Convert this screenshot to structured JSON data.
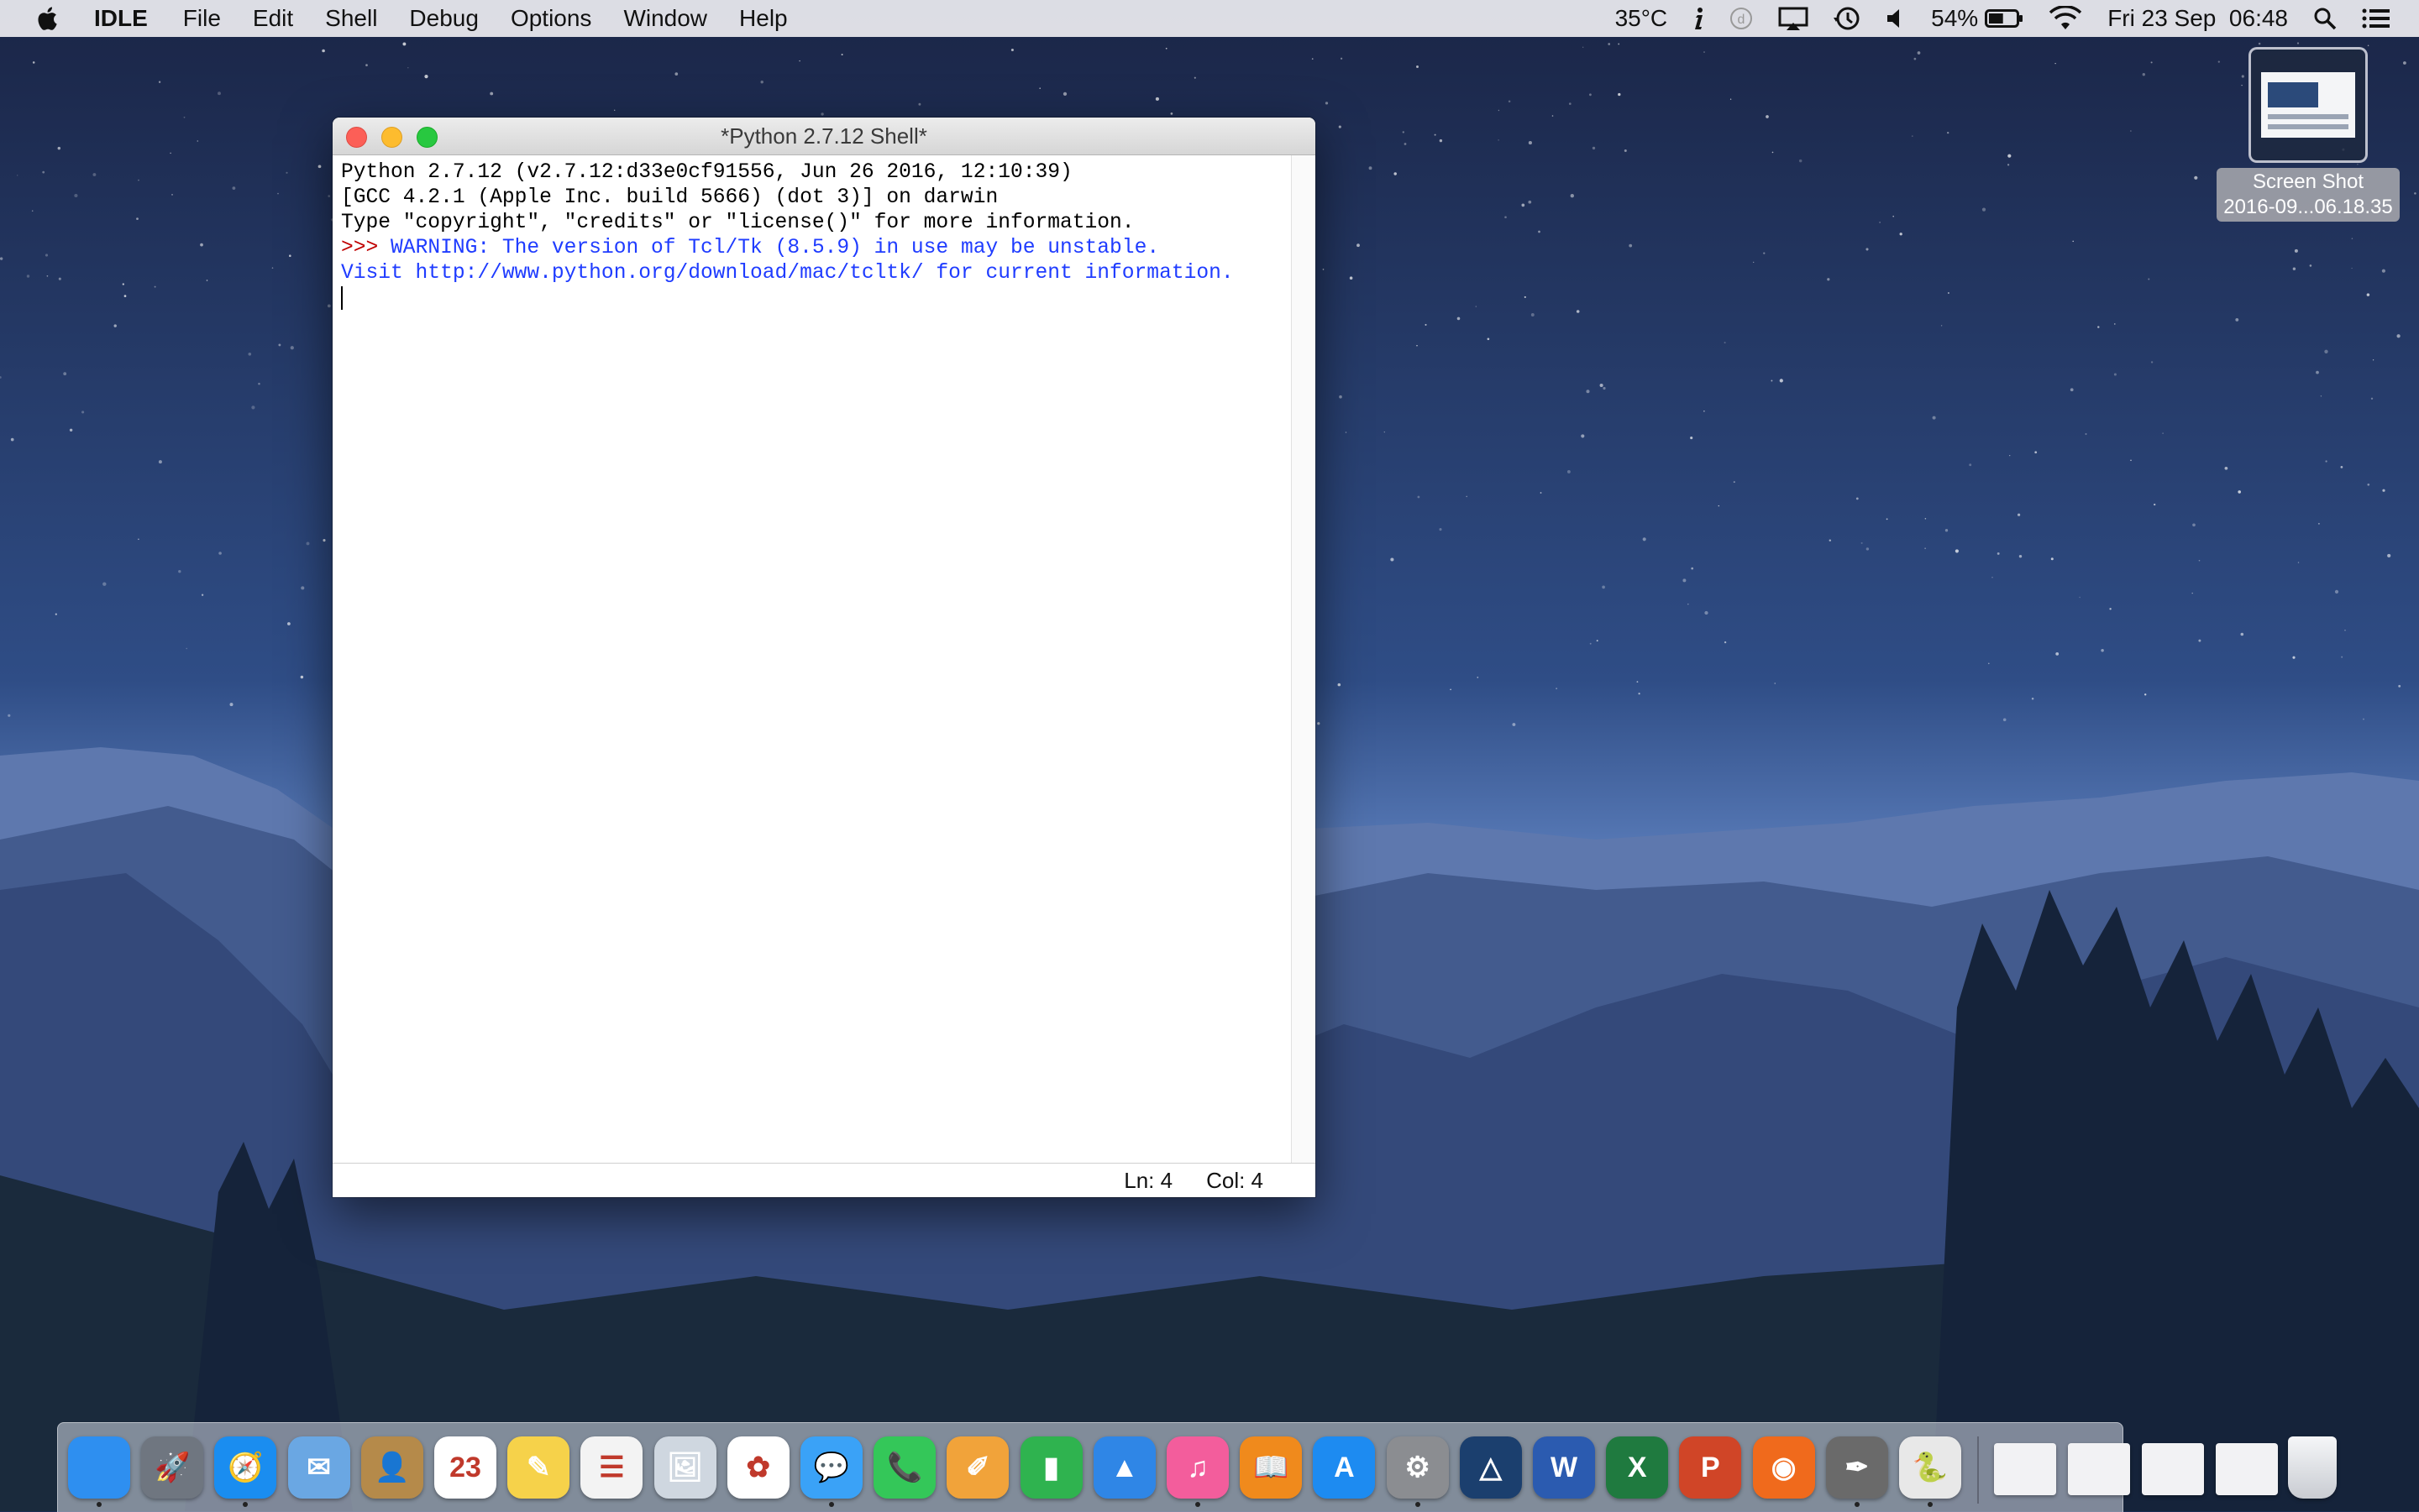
{
  "menubar": {
    "apple_icon": "apple-logo-icon",
    "app_name": "IDLE",
    "items": [
      "File",
      "Edit",
      "Shell",
      "Debug",
      "Options",
      "Window",
      "Help"
    ],
    "status": {
      "temperature": "35°C",
      "battery_percent": "54%",
      "battery_level": 0.54,
      "clock": "Fri 23 Sep  06:48",
      "icons": [
        "info-icon",
        "dashboard-icon",
        "airplay-icon",
        "time-machine-icon",
        "volume-icon",
        "battery-icon",
        "wifi-icon",
        "spotlight-icon",
        "notification-center-icon"
      ]
    }
  },
  "desktop": {
    "file_icon": {
      "label_line1": "Screen Shot",
      "label_line2": "2016-09...06.18.35"
    }
  },
  "window": {
    "title": "*Python 2.7.12 Shell*",
    "lines": [
      {
        "prompt": "",
        "text": "Python 2.7.12 (v2.7.12:d33e0cf91556, Jun 26 2016, 12:10:39)",
        "style": "stdout"
      },
      {
        "prompt": "",
        "text": "[GCC 4.2.1 (Apple Inc. build 5666) (dot 3)] on darwin",
        "style": "stdout"
      },
      {
        "prompt": "",
        "text": "Type \"copyright\", \"credits\" or \"license()\" for more information.",
        "style": "stdout"
      },
      {
        "prompt": ">>> ",
        "text": "WARNING: The version of Tcl/Tk (8.5.9) in use may be unstable.",
        "style": "stderr"
      },
      {
        "prompt": "",
        "text": "Visit http://www.python.org/download/mac/tcltk/ for current information.",
        "style": "stderr"
      }
    ],
    "status_ln": "Ln: 4",
    "status_col": "Col: 4"
  },
  "dock": {
    "apps": [
      {
        "name": "finder",
        "glyph": "",
        "color": "#2e8ff0",
        "running": true
      },
      {
        "name": "launchpad",
        "glyph": "🚀",
        "color": "#6f7680",
        "running": false
      },
      {
        "name": "safari",
        "glyph": "🧭",
        "color": "#1a8df0",
        "running": true
      },
      {
        "name": "mail",
        "glyph": "✉",
        "color": "#6aa7e3",
        "running": false
      },
      {
        "name": "contacts",
        "glyph": "👤",
        "color": "#b58a4a",
        "running": false
      },
      {
        "name": "calendar",
        "glyph": "23",
        "color": "#ffffff",
        "running": false
      },
      {
        "name": "notes",
        "glyph": "✎",
        "color": "#f6d24a",
        "running": false
      },
      {
        "name": "reminders",
        "glyph": "☰",
        "color": "#f3f3f3",
        "running": false
      },
      {
        "name": "preview",
        "glyph": "🖼",
        "color": "#cfd7e0",
        "running": false
      },
      {
        "name": "photos",
        "glyph": "✿",
        "color": "#ffffff",
        "running": false
      },
      {
        "name": "messages",
        "glyph": "💬",
        "color": "#3aa2f7",
        "running": true
      },
      {
        "name": "facetime",
        "glyph": "📞",
        "color": "#34c759",
        "running": false
      },
      {
        "name": "pages",
        "glyph": "✐",
        "color": "#f1a33a",
        "running": false
      },
      {
        "name": "numbers",
        "glyph": "▮",
        "color": "#2fb34f",
        "running": false
      },
      {
        "name": "keynote",
        "glyph": "▲",
        "color": "#2f86e6",
        "running": false
      },
      {
        "name": "itunes",
        "glyph": "♫",
        "color": "#f35d9c",
        "running": true
      },
      {
        "name": "ibooks",
        "glyph": "📖",
        "color": "#f08a1c",
        "running": false
      },
      {
        "name": "app-store",
        "glyph": "A",
        "color": "#1d8bf1",
        "running": false
      },
      {
        "name": "system-preferences",
        "glyph": "⚙",
        "color": "#8b8d91",
        "running": true
      },
      {
        "name": "affinity-designer",
        "glyph": "△",
        "color": "#1b3f6e",
        "running": false
      },
      {
        "name": "word",
        "glyph": "W",
        "color": "#2b5bb0",
        "running": false
      },
      {
        "name": "excel",
        "glyph": "X",
        "color": "#1f7a3f",
        "running": false
      },
      {
        "name": "powerpoint",
        "glyph": "P",
        "color": "#d04527",
        "running": false
      },
      {
        "name": "origin",
        "glyph": "◉",
        "color": "#f06a1c",
        "running": false
      },
      {
        "name": "pen-tool",
        "glyph": "✒",
        "color": "#6a6a6a",
        "running": true
      },
      {
        "name": "python-idle",
        "glyph": "🐍",
        "color": "#e8e8e8",
        "running": true
      }
    ],
    "minimized_windows": [
      "screenshot-1",
      "screenshot-2",
      "screenshot-3",
      "screenshot-4"
    ],
    "trash": "trash-icon"
  }
}
